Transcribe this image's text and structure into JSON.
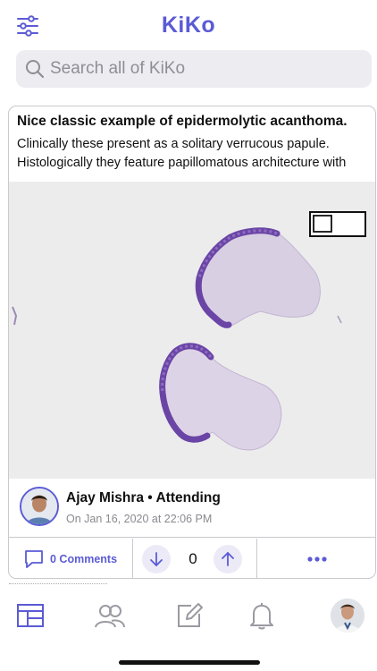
{
  "app": {
    "logo": "KiKo"
  },
  "header": {
    "filter_icon": "sliders-icon"
  },
  "search": {
    "placeholder": "Search all of KiKo",
    "icon": "search-icon"
  },
  "post": {
    "title": "Nice classic example of epidermolytic acanthoma.",
    "body": "Clinically these present as a solitary verrucous papule. Histologically they feature papillomatous architecture with",
    "slide_icon": "histology-slide-image",
    "author": {
      "name": "Ajay Mishra • Attending",
      "date": "On Jan 16, 2020 at 22:06 PM"
    },
    "actions": {
      "comments_label": "0 Comments",
      "vote_count": "0",
      "more_icon": "more-dots-icon"
    }
  },
  "tabbar": {
    "items": [
      "feed-icon",
      "people-icon",
      "compose-icon",
      "bell-icon",
      "profile-avatar"
    ]
  },
  "colors": {
    "accent": "#5b5bd6",
    "tissue": "#c9b9d6",
    "epidermis": "#6a45a6"
  }
}
